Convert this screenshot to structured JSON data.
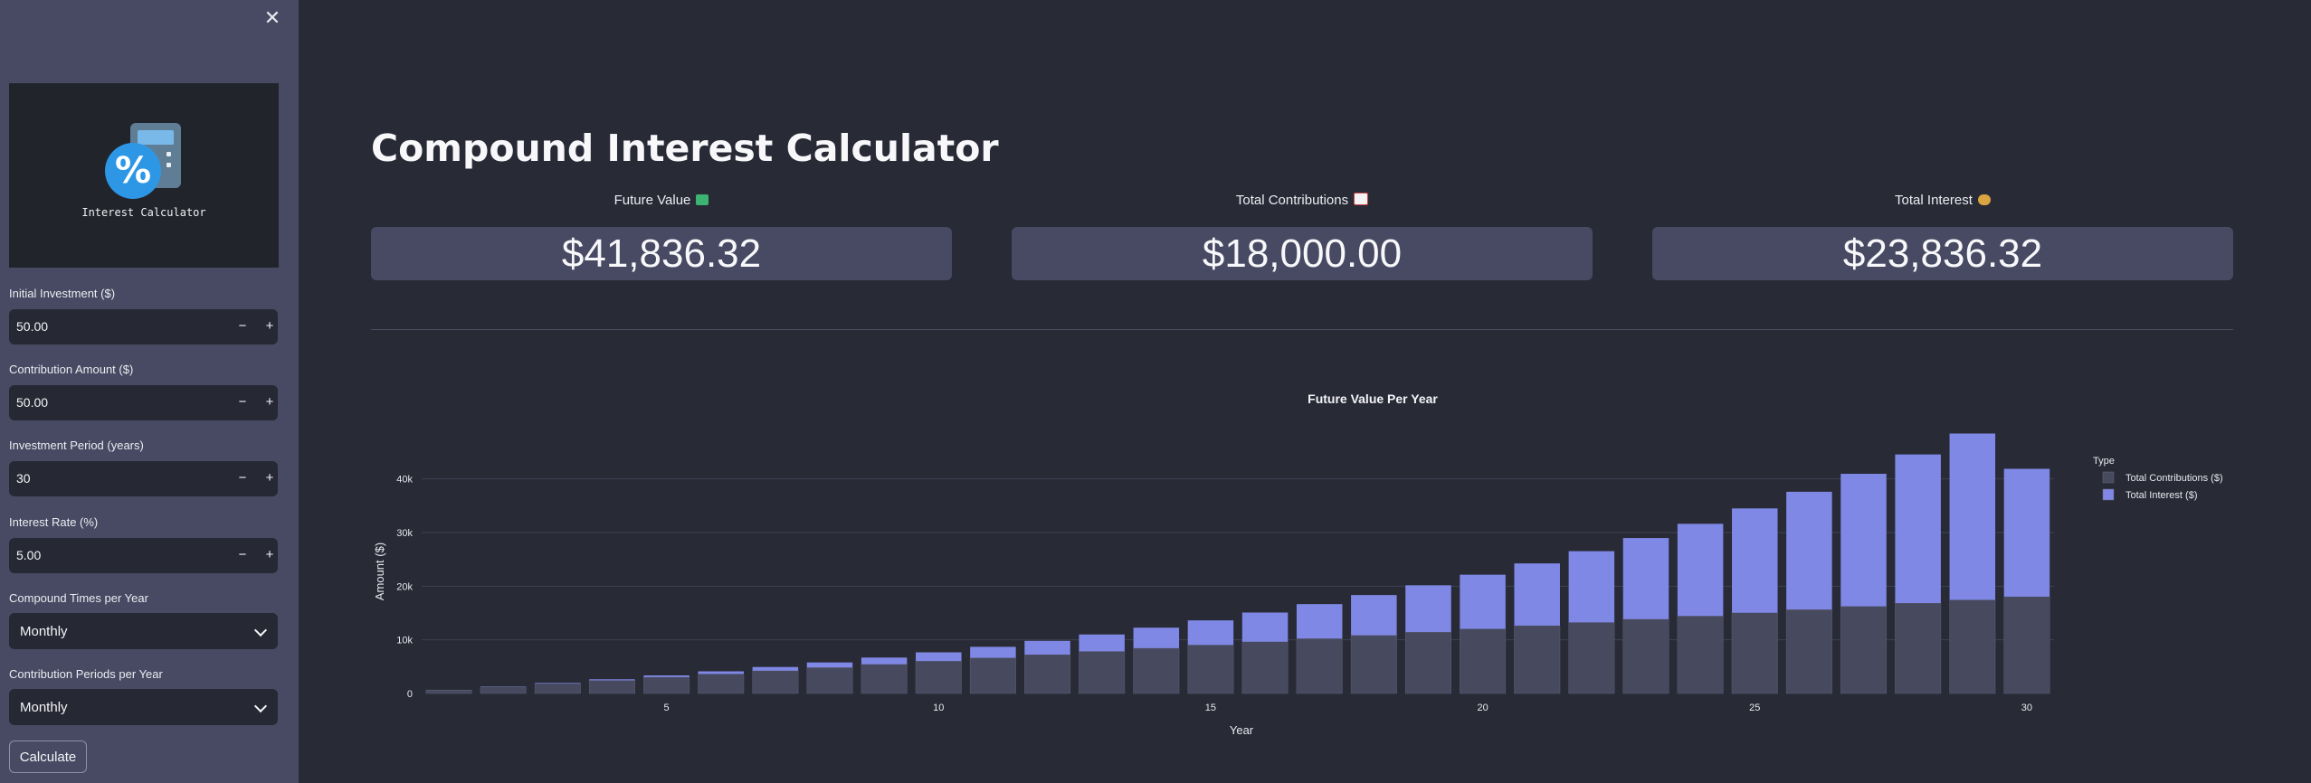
{
  "sidebar": {
    "logo_text": "Interest Calculator",
    "fields": [
      {
        "label": "Initial Investment ($)",
        "value": "50.00"
      },
      {
        "label": "Contribution Amount ($)",
        "value": "50.00"
      },
      {
        "label": "Investment Period (years)",
        "value": "30"
      },
      {
        "label": "Interest Rate (%)",
        "value": "5.00"
      }
    ],
    "selects": [
      {
        "label": "Compound Times per Year",
        "value": "Monthly"
      },
      {
        "label": "Contribution Periods per Year",
        "value": "Monthly"
      }
    ],
    "stepper_minus": "−",
    "stepper_plus": "+",
    "close_glyph": "✕",
    "calculate_label": "Calculate"
  },
  "main": {
    "title": "Compound Interest Calculator",
    "metrics": [
      {
        "label": "Future Value",
        "value": "$41,836.32",
        "icon": "money-emoji-icon",
        "icon_color": "#3cb371"
      },
      {
        "label": "Total Contributions",
        "value": "$18,000.00",
        "icon": "chart-up-emoji-icon",
        "icon_color": "#f3f3f3"
      },
      {
        "label": "Total Interest",
        "value": "$23,836.32",
        "icon": "money-bag-emoji-icon",
        "icon_color": "#d9a441"
      }
    ]
  },
  "chart_data": {
    "type": "bar",
    "stacked": true,
    "title": "Future Value Per Year",
    "xlabel": "Year",
    "ylabel": "Amount ($)",
    "x": [
      1,
      2,
      3,
      4,
      5,
      6,
      7,
      8,
      9,
      10,
      11,
      12,
      13,
      14,
      15,
      16,
      17,
      18,
      19,
      20,
      21,
      22,
      23,
      24,
      25,
      26,
      27,
      28,
      29,
      30
    ],
    "xticks": [
      5,
      10,
      15,
      20,
      25,
      30
    ],
    "yticks": [
      0,
      10000,
      20000,
      30000,
      40000
    ],
    "ytick_labels": [
      "0",
      "10k",
      "20k",
      "30k",
      "40k"
    ],
    "ylim": [
      0,
      45000
    ],
    "legend_title": "Type",
    "legend_position": "top-right",
    "grid": true,
    "series": [
      {
        "name": "Total Contributions ($)",
        "color": "#474a5e",
        "values": [
          650,
          1250,
          1850,
          2450,
          3050,
          3650,
          4250,
          4850,
          5450,
          6050,
          6650,
          7250,
          7850,
          8450,
          9050,
          9650,
          10250,
          10850,
          11450,
          12050,
          12650,
          13250,
          13850,
          14450,
          15050,
          15650,
          16250,
          16850,
          17450,
          18050
        ]
      },
      {
        "name": "Total Interest ($)",
        "color": "#7f88e4",
        "values": [
          15,
          50,
          110,
          200,
          320,
          480,
          690,
          940,
          1250,
          1620,
          2050,
          2560,
          3150,
          3820,
          4580,
          5440,
          6410,
          7500,
          8720,
          10090,
          11600,
          13280,
          15130,
          17180,
          19450,
          21950,
          24700,
          27710,
          31010,
          23836
        ]
      }
    ]
  }
}
